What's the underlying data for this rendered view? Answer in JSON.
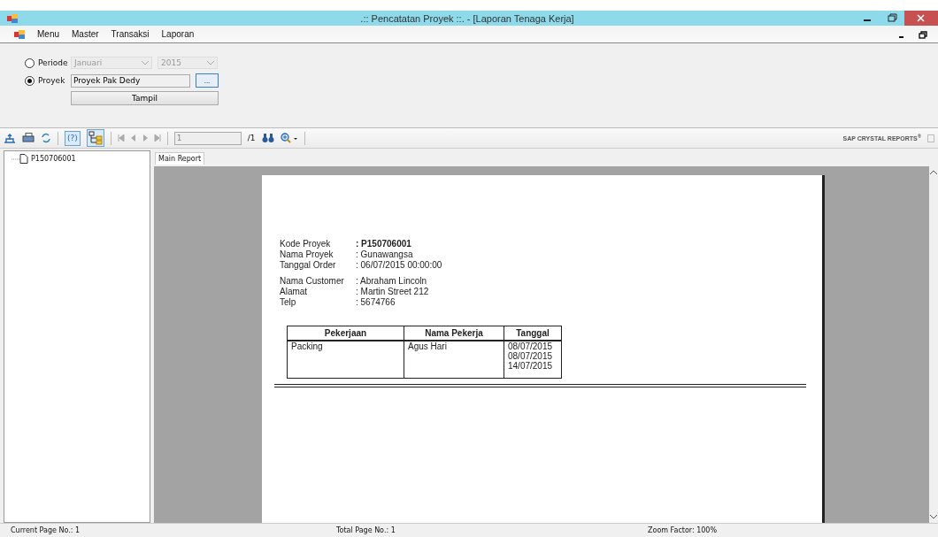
{
  "window": {
    "title": ".:: Pencatatan Proyek ::. - [Laporan Tenaga Kerja]"
  },
  "menu": [
    "Menu",
    "Master",
    "Transaksi",
    "Laporan"
  ],
  "filter": {
    "radios": [
      {
        "label": "Periode",
        "selected": false
      },
      {
        "label": "Proyek",
        "selected": true
      }
    ],
    "month": {
      "value": "Januari",
      "disabled": true
    },
    "year": {
      "value": "2015",
      "disabled": true
    },
    "project": {
      "value": "Proyek Pak Dedy"
    },
    "browse_button": "...",
    "show_button": "Tampil"
  },
  "toolbar": {
    "help_button": "(?)",
    "page_field": "1",
    "page_total": "/1",
    "brand": "SAP CRYSTAL REPORTS$^{®}$"
  },
  "tree": [
    {
      "label": "P150706001"
    }
  ],
  "report_tabs": [
    {
      "label": "Main Report",
      "selected": true
    }
  ],
  "report": {
    "groups": [
      [
        {
          "label": "Kode Proyek",
          "value": ": P150706001",
          "bold": true
        },
        {
          "label": "Nama Proyek",
          "value": ": Gunawangsa",
          "bold": false
        },
        {
          "label": "Tanggal Order",
          "value": ": 06/07/2015  00:00:00",
          "bold": false
        }
      ],
      [
        {
          "label": "Nama Customer",
          "value": ": Abraham Lincoln",
          "bold": false
        },
        {
          "label": "Alamat",
          "value": ": Martin Street 212",
          "bold": false
        },
        {
          "label": "Telp",
          "value": ": 5674766",
          "bold": false
        }
      ]
    ],
    "table": {
      "columns": [
        "Pekerjaan",
        "Nama Pekerja",
        "Tanggal"
      ],
      "rows": [
        {
          "cells": [
            [
              "Packing"
            ],
            [
              "Agus Hari"
            ],
            [
              "08/07/2015",
              "08/07/2015",
              "14/07/2015"
            ]
          ]
        }
      ]
    }
  },
  "status_bar": [
    "Current Page No.: 1",
    "Total Page No.: 1",
    "Zoom Factor: 100%"
  ]
}
